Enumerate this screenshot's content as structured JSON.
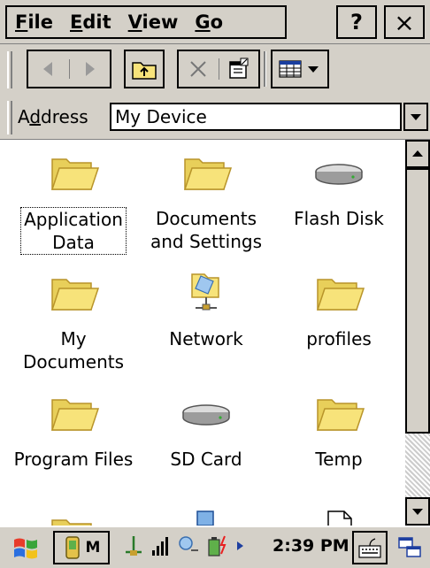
{
  "menu": {
    "items": [
      {
        "label": "File",
        "accel": "F",
        "rest": "ile"
      },
      {
        "label": "Edit",
        "accel": "E",
        "rest": "dit"
      },
      {
        "label": "View",
        "accel": "V",
        "rest": "iew"
      },
      {
        "label": "Go",
        "accel": "G",
        "rest": "o"
      }
    ],
    "help_label": "?",
    "close_label": "×"
  },
  "address": {
    "label": "Address",
    "label_accel": "d",
    "value": "My Device"
  },
  "files": [
    {
      "name": "Application Data",
      "line1": "Application",
      "line2": "Data",
      "icon": "folder-icon",
      "selected": true
    },
    {
      "name": "Documents and Settings",
      "line1": "Documents",
      "line2": "and Settings",
      "icon": "folder-icon",
      "selected": false
    },
    {
      "name": "Flash Disk",
      "line1": "Flash Disk",
      "line2": "",
      "icon": "drive-icon",
      "selected": false
    },
    {
      "name": "My Documents",
      "line1": "My",
      "line2": "Documents",
      "icon": "folder-icon",
      "selected": false
    },
    {
      "name": "Network",
      "line1": "Network",
      "line2": "",
      "icon": "network-icon",
      "selected": false
    },
    {
      "name": "profiles",
      "line1": "profiles",
      "line2": "",
      "icon": "folder-icon",
      "selected": false
    },
    {
      "name": "Program Files",
      "line1": "Program Files",
      "line2": "",
      "icon": "folder-icon",
      "selected": false
    },
    {
      "name": "SD Card",
      "line1": "SD Card",
      "line2": "",
      "icon": "drive-icon",
      "selected": false
    },
    {
      "name": "Temp",
      "line1": "Temp",
      "line2": "",
      "icon": "folder-icon",
      "selected": false
    }
  ],
  "taskbar": {
    "task_label": "M",
    "clock": "2:39 PM"
  },
  "colors": {
    "chrome": "#d4d0c8",
    "folder": "#f7e37a",
    "folder_edge": "#b8942a"
  }
}
